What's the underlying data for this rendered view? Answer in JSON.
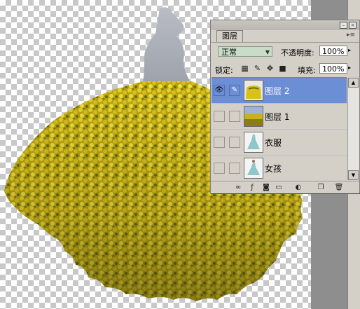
{
  "panel": {
    "tab_label": "图层",
    "blend_mode": "正常",
    "opacity_label": "不透明度:",
    "opacity_value": "100%",
    "lock_label": "锁定:",
    "fill_label": "填充:",
    "fill_value": "100%",
    "layers": [
      {
        "name": "图层 2",
        "visible": true,
        "linked_icon": "brush-icon",
        "selected": true,
        "thumbnail": "flowers"
      },
      {
        "name": "图层 1",
        "visible": false,
        "linked_icon": "",
        "selected": false,
        "thumbnail": "field"
      },
      {
        "name": "衣服",
        "visible": false,
        "linked_icon": "",
        "selected": false,
        "thumbnail": "dress"
      },
      {
        "name": "女孩",
        "visible": false,
        "linked_icon": "",
        "selected": false,
        "thumbnail": "girl"
      }
    ],
    "footer_icons": [
      "link-layers-icon",
      "layer-style-icon",
      "mask-icon",
      "group-icon",
      "adjustment-layer-icon",
      "new-layer-icon",
      "trash-icon"
    ]
  },
  "colors": {
    "selection": "#6c8ed4",
    "panel_bg": "#d4d0c8",
    "flower_yellow": "#d8c21a"
  }
}
